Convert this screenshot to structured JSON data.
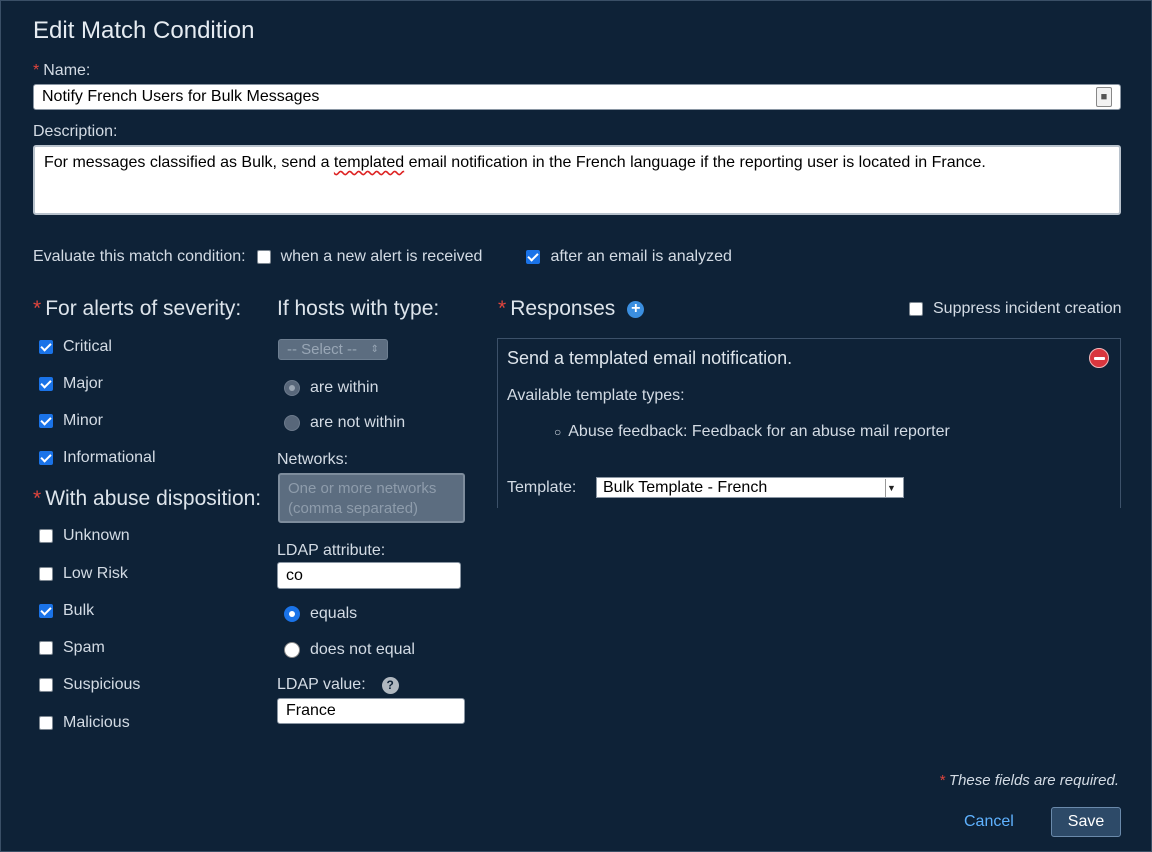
{
  "dialog": {
    "title": "Edit Match Condition",
    "required_mark": "*",
    "name_label": "Name:",
    "name_value": "Notify French Users for Bulk Messages",
    "description_label": "Description:",
    "description_before": "For messages classified as Bulk, send a ",
    "description_misspelled": "templated",
    "description_after": " email notification in the French language if the reporting user is located in France."
  },
  "evaluate": {
    "label": "Evaluate this match condition:",
    "options": [
      {
        "label": "when a new alert is received",
        "checked": false
      },
      {
        "label": "after an email is analyzed",
        "checked": true
      }
    ]
  },
  "severity": {
    "heading": "For alerts of severity:",
    "items": [
      {
        "label": "Critical",
        "checked": true
      },
      {
        "label": "Major",
        "checked": true
      },
      {
        "label": "Minor",
        "checked": true
      },
      {
        "label": "Informational",
        "checked": true
      }
    ]
  },
  "disposition": {
    "heading": "With abuse disposition:",
    "items": [
      {
        "label": "Unknown",
        "checked": false
      },
      {
        "label": "Low Risk",
        "checked": false
      },
      {
        "label": "Bulk",
        "checked": true
      },
      {
        "label": "Spam",
        "checked": false
      },
      {
        "label": "Suspicious",
        "checked": false
      },
      {
        "label": "Malicious",
        "checked": false
      }
    ]
  },
  "hosts": {
    "heading": "If hosts with type:",
    "select_value": "-- Select --",
    "within_label": "are within",
    "not_within_label": "are not within",
    "networks_label": "Networks:",
    "networks_placeholder": "One or more networks (comma separated)",
    "ldap_attr_label": "LDAP attribute:",
    "ldap_attr_value": "co",
    "equals_label": "equals",
    "not_equal_label": "does not equal",
    "ldap_value_label": "LDAP value:",
    "ldap_value": "France"
  },
  "responses": {
    "heading": "Responses",
    "suppress_label": "Suppress incident creation",
    "suppress_checked": false,
    "panel_title": "Send a templated email notification.",
    "available_label": "Available template types:",
    "template_type_item": "Abuse feedback: Feedback for an abuse mail reporter",
    "bullet": "○",
    "template_label": "Template:",
    "template_value": "Bulk Template - French"
  },
  "footer": {
    "required_note": "These fields are required.",
    "cancel_label": "Cancel",
    "save_label": "Save"
  },
  "colors": {
    "background": "#0e2237",
    "accent": "#1a73e8",
    "required": "#e0453d",
    "link": "#5fb2ff"
  }
}
